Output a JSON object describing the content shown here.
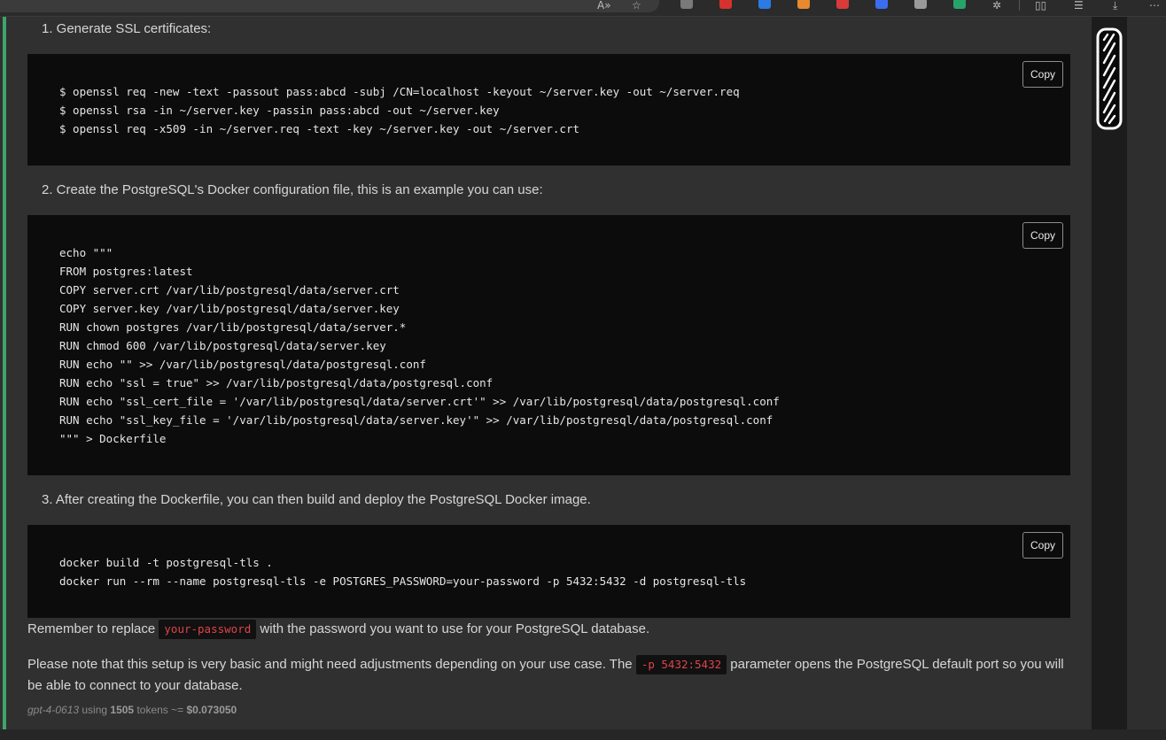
{
  "toolbar": {
    "read_aloud_icon": "read-aloud-icon",
    "favorite_icon": "star-icon",
    "extensions": [
      {
        "name": "extension-1-icon",
        "color": "#7a7a7a"
      },
      {
        "name": "extension-2-icon",
        "color": "#d6312f"
      },
      {
        "name": "extension-3-icon",
        "color": "#2c7be5"
      },
      {
        "name": "extension-4-icon",
        "color": "#e8892e"
      },
      {
        "name": "extension-5-icon",
        "color": "#d83a3a"
      },
      {
        "name": "extension-6-icon",
        "color": "#3a6df0"
      },
      {
        "name": "extension-7-icon",
        "color": "#9a9a9a"
      },
      {
        "name": "extension-8-icon",
        "color": "#27a36a"
      }
    ]
  },
  "steps": [
    {
      "label": "1. Generate SSL certificates:"
    },
    {
      "label": "2. Create the PostgreSQL's Docker configuration file, this is an example you can use:"
    },
    {
      "label": "3. After creating the Dockerfile, you can then build and deploy the PostgreSQL Docker image."
    }
  ],
  "code_blocks": [
    {
      "copy_label": "Copy",
      "code": "$ openssl req -new -text -passout pass:abcd -subj /CN=localhost -keyout ~/server.key -out ~/server.req\n$ openssl rsa -in ~/server.key -passin pass:abcd -out ~/server.key\n$ openssl req -x509 -in ~/server.req -text -key ~/server.key -out ~/server.crt"
    },
    {
      "copy_label": "Copy",
      "code": "echo \"\"\"\nFROM postgres:latest\nCOPY server.crt /var/lib/postgresql/data/server.crt\nCOPY server.key /var/lib/postgresql/data/server.key\nRUN chown postgres /var/lib/postgresql/data/server.*\nRUN chmod 600 /var/lib/postgresql/data/server.key\nRUN echo \"\" >> /var/lib/postgresql/data/postgresql.conf\nRUN echo \"ssl = true\" >> /var/lib/postgresql/data/postgresql.conf\nRUN echo \"ssl_cert_file = '/var/lib/postgresql/data/server.crt'\" >> /var/lib/postgresql/data/postgresql.conf\nRUN echo \"ssl_key_file = '/var/lib/postgresql/data/server.key'\" >> /var/lib/postgresql/data/postgresql.conf\n\"\"\" > Dockerfile"
    },
    {
      "copy_label": "Copy",
      "code": "docker build -t postgresql-tls .\ndocker run --rm --name postgresql-tls -e POSTGRES_PASSWORD=your-password -p 5432:5432 -d postgresql-tls"
    }
  ],
  "notes": {
    "remember_before": "Remember to replace ",
    "remember_code": "your-password",
    "remember_after": " with the password you want to use for your PostgreSQL database.",
    "basic_before": "Please note that this setup is very basic and might need adjustments depending on your use case. The ",
    "basic_code": "-p 5432:5432",
    "basic_after": " parameter opens the PostgreSQL default port so you will be able to connect to your database."
  },
  "footer": {
    "model": "gpt-4-0613",
    "using": " using ",
    "tokens": "1505",
    "tokens_label": " tokens ~= ",
    "cost": "$0.073050"
  },
  "colors": {
    "accent_green": "#3fa56a",
    "inline_code": "#e0434b"
  }
}
